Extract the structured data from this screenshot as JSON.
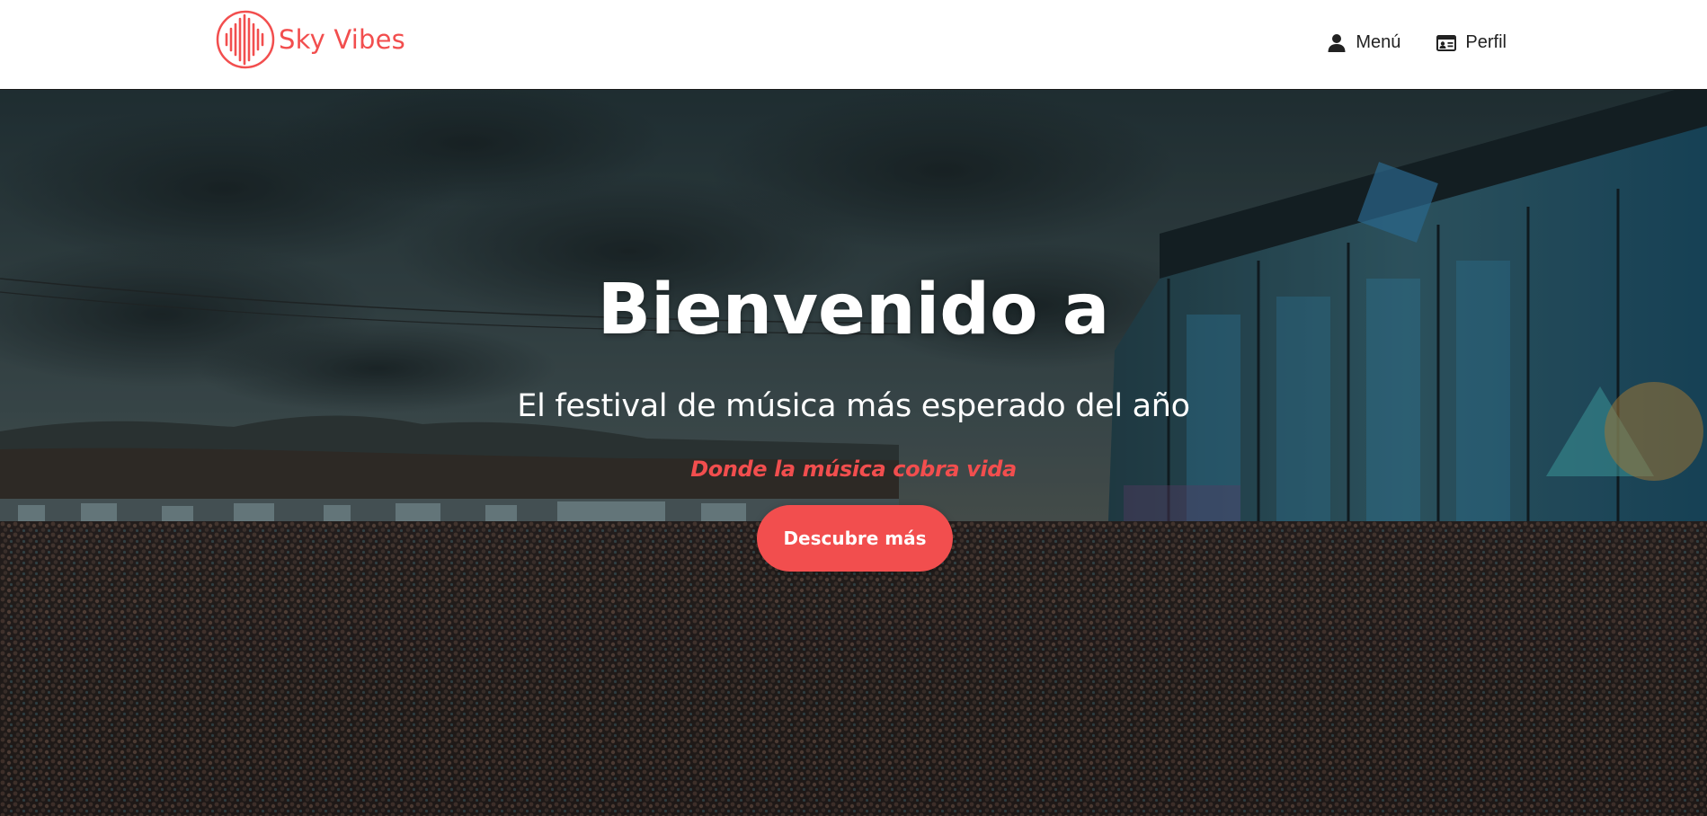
{
  "brand": {
    "name": "Sky Vibes",
    "accent_color": "#f24e4e",
    "logo_icon": "soundwave-circle-icon"
  },
  "nav": {
    "items": [
      {
        "label": "Menú",
        "icon": "user-icon"
      },
      {
        "label": "Perfil",
        "icon": "id-card-icon"
      }
    ]
  },
  "hero": {
    "title": "Bienvenido a",
    "subtitle": "El festival de música más esperado del año",
    "tagline": "Donde la música cobra vida",
    "cta_label": "Descubre más",
    "background": "festival-crowd-stage-photo"
  }
}
